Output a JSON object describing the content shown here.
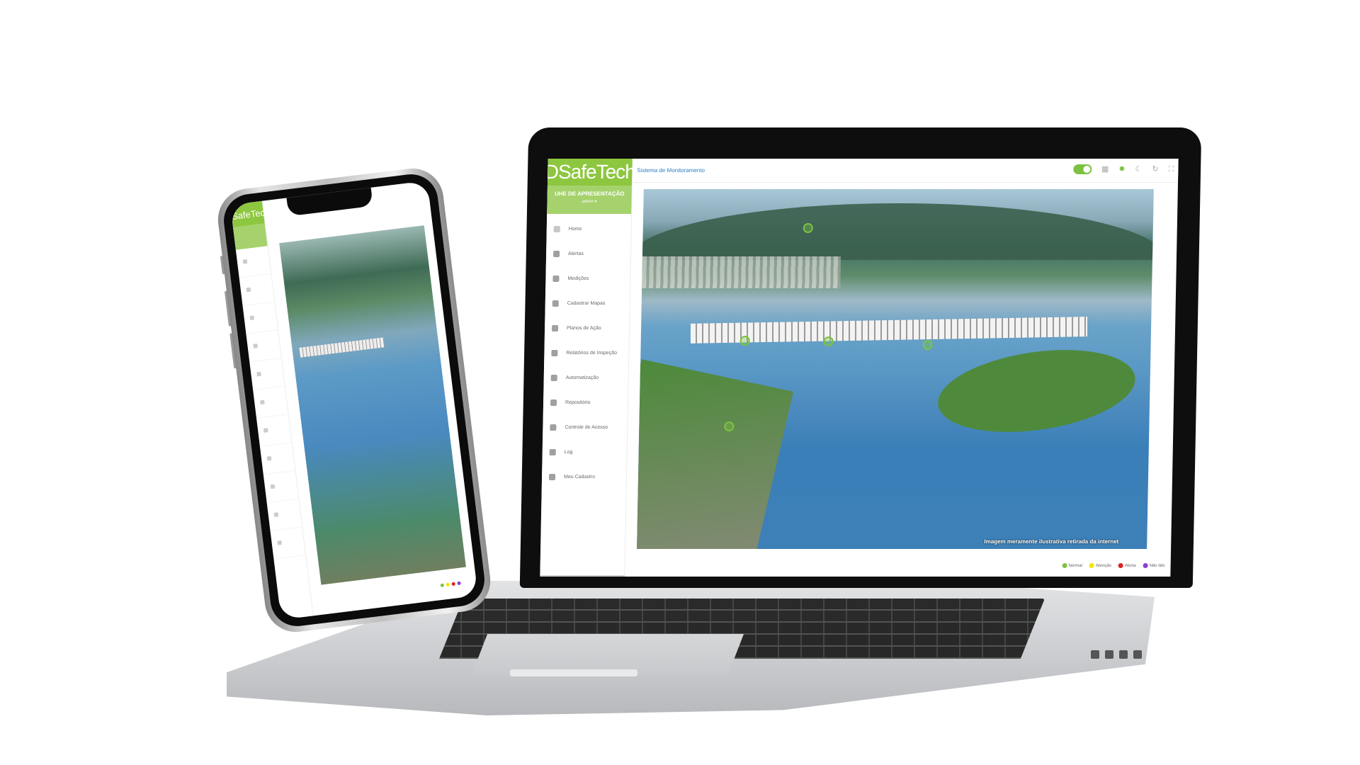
{
  "app": {
    "brand": "DSafeTech",
    "unit_name": "UHE DE APRESENTAÇÃO",
    "user_label": "admin ▾"
  },
  "topbar": {
    "title": "Sistema de Monitoramento",
    "icons": [
      "toggle-switch",
      "building-icon",
      "sun-icon",
      "moon-icon",
      "refresh-icon",
      "fullscreen-icon"
    ]
  },
  "sidebar": {
    "items": [
      {
        "label": "Home",
        "icon": "home-icon"
      },
      {
        "label": "Alertas",
        "icon": "warning-icon"
      },
      {
        "label": "Medições",
        "icon": "measure-icon"
      },
      {
        "label": "Cadastrar Mapas",
        "icon": "map-icon"
      },
      {
        "label": "Planos de Ação",
        "icon": "list-icon"
      },
      {
        "label": "Relatórios de Inspeção",
        "icon": "report-icon"
      },
      {
        "label": "Automatização",
        "icon": "cogs-icon"
      },
      {
        "label": "Repositório",
        "icon": "folder-icon"
      },
      {
        "label": "Controle de Acesso",
        "icon": "users-icon"
      },
      {
        "label": "Log",
        "icon": "log-icon"
      },
      {
        "label": "Meu Cadastro",
        "icon": "user-icon"
      }
    ]
  },
  "map": {
    "caption": "Imagem meramente ilustrativa retirada da internet"
  },
  "legend": [
    {
      "label": "Normal",
      "color": "#7cc242"
    },
    {
      "label": "Atenção",
      "color": "#f2e500"
    },
    {
      "label": "Alerta",
      "color": "#e02020"
    },
    {
      "label": "Não lido",
      "color": "#8a3fd0"
    }
  ],
  "mobile": {
    "brand": "DSafeTech"
  }
}
